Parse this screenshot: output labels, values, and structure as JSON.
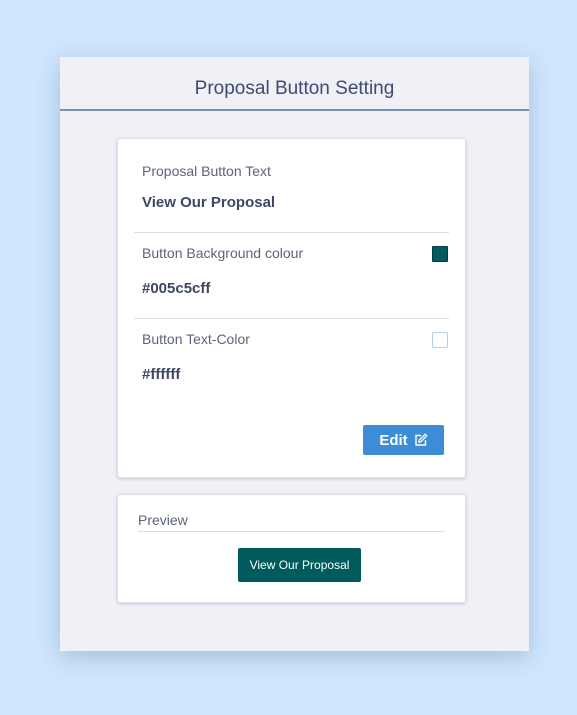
{
  "page": {
    "title": "Proposal Button Setting"
  },
  "settings": {
    "button_text": {
      "label": "Proposal Button Text",
      "value": "View Our Proposal"
    },
    "background_colour": {
      "label": "Button Background colour",
      "value": "#005c5cff",
      "swatch_color": "#005c5c"
    },
    "text_colour": {
      "label": "Button Text-Color",
      "value": "#ffffff",
      "swatch_color": "#ffffff"
    },
    "edit_button": {
      "label": "Edit",
      "icon": "edit-icon",
      "color": "#3c8dd5"
    }
  },
  "preview": {
    "label": "Preview",
    "button_text": "View Our Proposal"
  }
}
